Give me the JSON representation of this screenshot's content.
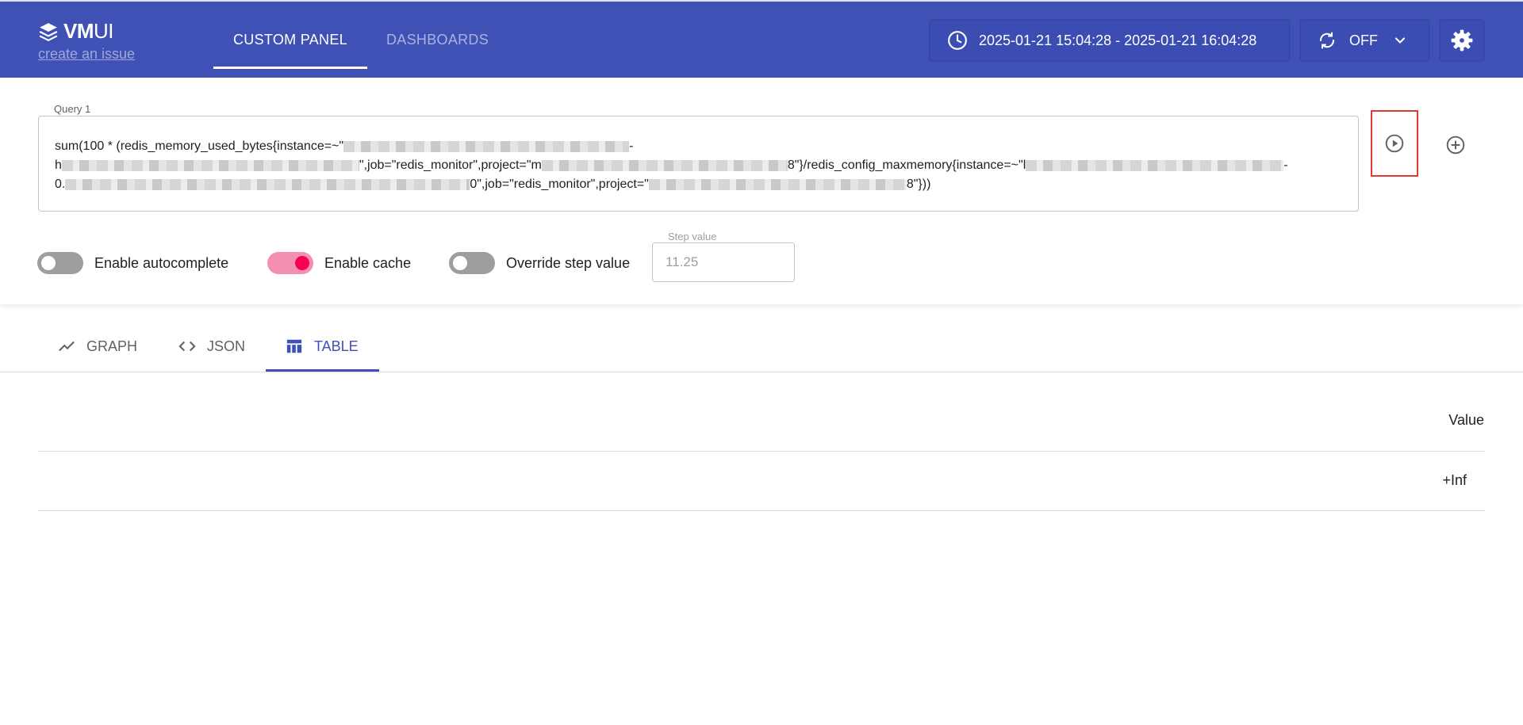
{
  "header": {
    "logo_bold": "VM",
    "logo_thin": "UI",
    "issue_link": "create an issue",
    "tabs": [
      {
        "label": "CUSTOM PANEL",
        "active": true
      },
      {
        "label": "DASHBOARDS",
        "active": false
      }
    ],
    "time_range": "2025-01-21 15:04:28 - 2025-01-21 16:04:28",
    "refresh": "OFF",
    "icons": {
      "time": "clock-icon",
      "refresh": "refresh-icon",
      "dropdown": "chevron-down-icon",
      "settings": "gear-icon"
    }
  },
  "query": {
    "label": "Query 1",
    "line1_a": "sum(100 * (redis_memory_used_bytes{instance=~\"",
    "line1_b": "-",
    "line2_a": "h",
    "line2_b": "\",job=\"redis_monitor\",project=\"m",
    "line2_c": "8\"}/redis_config_maxmemory{instance=~\"l",
    "line2_d": "-",
    "line3_a": "0.",
    "line3_b": "0\",job=\"redis_monitor\",project=\"",
    "line3_c": "8\"}))"
  },
  "options": {
    "autocomplete_label": "Enable autocomplete",
    "autocomplete_on": false,
    "cache_label": "Enable cache",
    "cache_on": true,
    "override_label": "Override step value",
    "override_on": false,
    "step_label": "Step value",
    "step_placeholder": "11.25"
  },
  "view_tabs": [
    {
      "label": "GRAPH",
      "active": false
    },
    {
      "label": "JSON",
      "active": false
    },
    {
      "label": "TABLE",
      "active": true
    }
  ],
  "table": {
    "columns": [
      "Value"
    ],
    "rows": [
      [
        "+Inf"
      ]
    ]
  },
  "colors": {
    "brand": "#3f51b5",
    "accent": "#f50057",
    "highlight_border": "#e53935"
  }
}
